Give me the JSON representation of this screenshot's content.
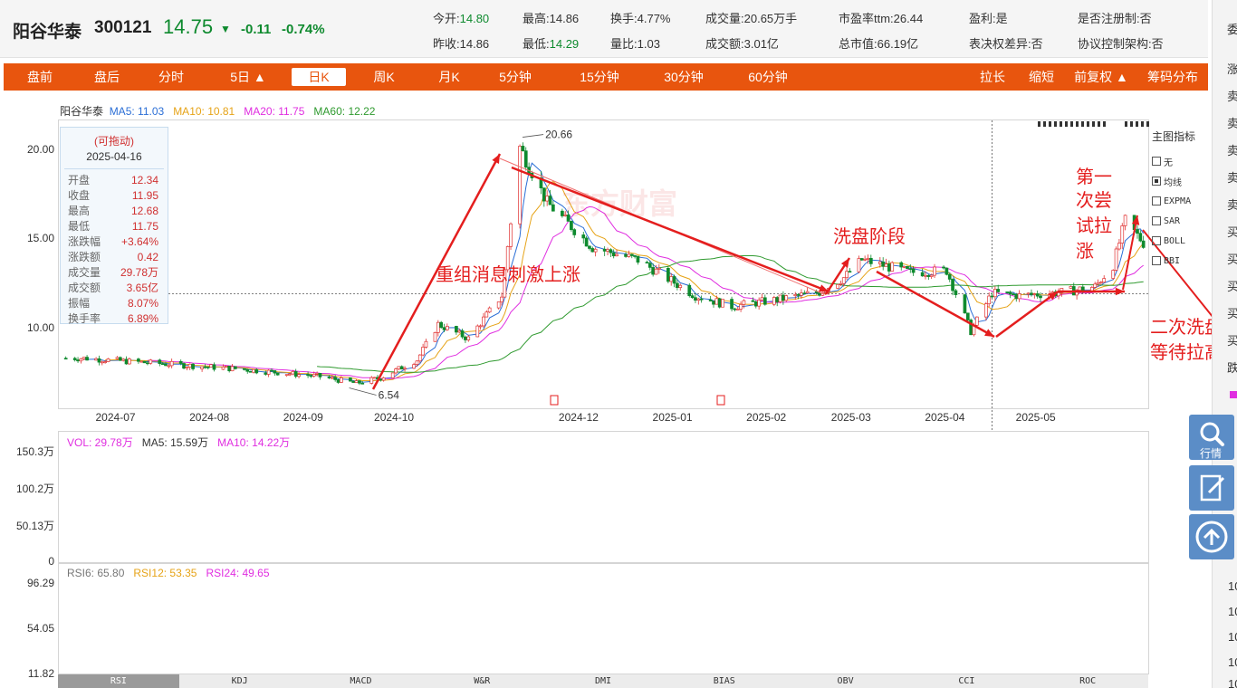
{
  "header": {
    "stock_name": "阳谷华泰",
    "stock_code": "300121",
    "price": "14.75",
    "price_arrow": "▼",
    "change": "-0.11",
    "change_pct": "-0.74%",
    "stats": [
      {
        "label": "今开:",
        "value": "14.80",
        "green": true
      },
      {
        "label": "最高:",
        "value": "14.86",
        "green": false
      },
      {
        "label": "换手:",
        "value": "4.77%",
        "green": false
      },
      {
        "label": "成交量:",
        "value": "20.65万手",
        "green": false
      },
      {
        "label": "市盈率ttm:",
        "value": "26.44",
        "green": false
      },
      {
        "label": "盈利:",
        "value": "是",
        "green": false
      },
      {
        "label": "是否注册制:",
        "value": "否",
        "green": false
      },
      {
        "label": "昨收:",
        "value": "14.86",
        "green": false
      },
      {
        "label": "最低:",
        "value": "14.29",
        "green": true
      },
      {
        "label": "量比:",
        "value": "1.03",
        "green": false
      },
      {
        "label": "成交额:",
        "value": "3.01亿",
        "green": false
      },
      {
        "label": "总市值:",
        "value": "66.19亿",
        "green": false
      },
      {
        "label": "表决权差异:",
        "value": "否",
        "green": false
      },
      {
        "label": "协议控制架构:",
        "value": "否",
        "green": false
      }
    ]
  },
  "toolbar": {
    "left": [
      "盘前",
      "盘后",
      "分时",
      "5日 ▲",
      "日K",
      "周K",
      "月K",
      "5分钟",
      "15分钟",
      "30分钟",
      "60分钟"
    ],
    "active": "日K",
    "right": [
      "拉长",
      "缩短",
      "前复权 ▲",
      "筹码分布"
    ]
  },
  "main_legend": {
    "name": "阳谷华泰",
    "ma5": "MA5: 11.03",
    "ma10": "MA10: 10.81",
    "ma20": "MA20: 11.75",
    "ma60": "MA60: 12.22"
  },
  "info_box": {
    "drag_label": "(可拖动)",
    "date": "2025-04-16",
    "rows": [
      {
        "label": "开盘",
        "value": "12.34"
      },
      {
        "label": "收盘",
        "value": "11.95"
      },
      {
        "label": "最高",
        "value": "12.68"
      },
      {
        "label": "最低",
        "value": "11.75"
      },
      {
        "label": "涨跌幅",
        "value": "+3.64%"
      },
      {
        "label": "涨跌额",
        "value": "0.42"
      },
      {
        "label": "成交量",
        "value": "29.78万"
      },
      {
        "label": "成交额",
        "value": "3.65亿"
      },
      {
        "label": "振幅",
        "value": "8.07%"
      },
      {
        "label": "换手率",
        "value": "6.89%"
      }
    ]
  },
  "indicator_panel": {
    "title": "主图指标",
    "items": [
      {
        "label": "无",
        "checked": false
      },
      {
        "label": "均线",
        "checked": true
      },
      {
        "label": "EXPMA",
        "checked": false
      },
      {
        "label": "SAR",
        "checked": false
      },
      {
        "label": "BOLL",
        "checked": false
      },
      {
        "label": "BBI",
        "checked": false
      }
    ]
  },
  "annotations": {
    "rise": "重组消息刺激上涨",
    "wash1": "洗盘阶段",
    "try1_l1": "第一",
    "try1_l2": "次尝",
    "try1_l3": "试拉",
    "try1_l4": "涨",
    "wash2_l1": "二次洗盘",
    "wash2_l2": "等待拉高",
    "high_label": "20.66",
    "low_label": "6.54",
    "watermark": "东方财富"
  },
  "volume_legend": {
    "vol": "VOL: 29.78万",
    "ma5": "MA5: 15.59万",
    "ma10": "MA10: 14.22万"
  },
  "rsi_legend": {
    "rsi6": "RSI6: 65.80",
    "rsi12": "RSI12: 53.35",
    "rsi24": "RSI24: 49.65"
  },
  "bottom_tabs": [
    "RSI",
    "KDJ",
    "MACD",
    "W&R",
    "DMI",
    "BIAS",
    "OBV",
    "CCI",
    "ROC"
  ],
  "bottom_active": "RSI",
  "right_strip": [
    "委",
    "涨",
    "卖",
    "卖",
    "卖",
    "卖",
    "卖",
    "买",
    "买",
    "买",
    "买",
    "买",
    "跌"
  ],
  "right_strip_lower": [
    "10",
    "10",
    "10",
    "10",
    "10"
  ],
  "side_buttons": {
    "quote": "行情"
  },
  "colors": {
    "up": "#e03030",
    "down": "#0e8a2e",
    "ma5": "#2c6fd6",
    "ma10": "#e6a317",
    "ma20": "#e02ee0",
    "ma60": "#2f9a2f",
    "toolbar": "#e8550e"
  },
  "chart_data": [
    {
      "type": "candlestick",
      "title": "",
      "x_ticks": [
        "2024-07",
        "2024-08",
        "2024-09",
        "2024-10",
        "2024-12",
        "2025-01",
        "2025-02",
        "2025-03",
        "2025-04",
        "2025-05"
      ],
      "y_ticks": [
        "20.00",
        "15.00",
        "10.00"
      ],
      "ylim": [
        5.5,
        21.6
      ],
      "close_keypoints": [
        {
          "date": "2024-06-20",
          "close": 8.3
        },
        {
          "date": "2024-07-15",
          "close": 8.0
        },
        {
          "date": "2024-08-10",
          "close": 7.7
        },
        {
          "date": "2024-09-05",
          "close": 7.3
        },
        {
          "date": "2024-09-18",
          "close": 6.9
        },
        {
          "date": "2024-09-26",
          "close": 7.2
        },
        {
          "date": "2024-10-08",
          "close": 8.2
        },
        {
          "date": "2024-10-15",
          "close": 10.2
        },
        {
          "date": "2024-10-25",
          "close": 9.4
        },
        {
          "date": "2024-11-05",
          "close": 11.8
        },
        {
          "date": "2024-11-11",
          "close": 20.1
        },
        {
          "date": "2024-11-20",
          "close": 17.0
        },
        {
          "date": "2024-12-05",
          "close": 14.5
        },
        {
          "date": "2024-12-20",
          "close": 13.8
        },
        {
          "date": "2025-01-08",
          "close": 11.8
        },
        {
          "date": "2025-01-20",
          "close": 11.2
        },
        {
          "date": "2025-02-05",
          "close": 11.6
        },
        {
          "date": "2025-02-18",
          "close": 12.0
        },
        {
          "date": "2025-02-26",
          "close": 12.8
        },
        {
          "date": "2025-03-04",
          "close": 13.8
        },
        {
          "date": "2025-03-20",
          "close": 13.1
        },
        {
          "date": "2025-04-01",
          "close": 13.2
        },
        {
          "date": "2025-04-09",
          "close": 9.8
        },
        {
          "date": "2025-04-16",
          "close": 11.95
        },
        {
          "date": "2025-04-25",
          "close": 11.8
        },
        {
          "date": "2025-05-10",
          "close": 12.0
        },
        {
          "date": "2025-05-20",
          "close": 12.3
        },
        {
          "date": "2025-05-26",
          "close": 13.5
        },
        {
          "date": "2025-05-30",
          "close": 16.0
        },
        {
          "date": "2025-06-05",
          "close": 14.75
        }
      ],
      "high_point": {
        "date": "2024-11-11",
        "value": 20.66
      },
      "low_point": {
        "date": "2024-09-18",
        "value": 6.54
      }
    },
    {
      "type": "bar",
      "title": "",
      "series_name": "VOL",
      "y_ticks": [
        "150.3万",
        "100.2万",
        "50.13万",
        "0"
      ],
      "ylim": [
        0,
        150.3
      ],
      "unit": "万"
    },
    {
      "type": "line",
      "title": "",
      "series": [
        {
          "name": "RSI6"
        },
        {
          "name": "RSI12"
        },
        {
          "name": "RSI24"
        }
      ],
      "y_ticks": [
        "96.29",
        "54.05",
        "11.82"
      ],
      "ylim": [
        11.82,
        96.29
      ]
    }
  ]
}
